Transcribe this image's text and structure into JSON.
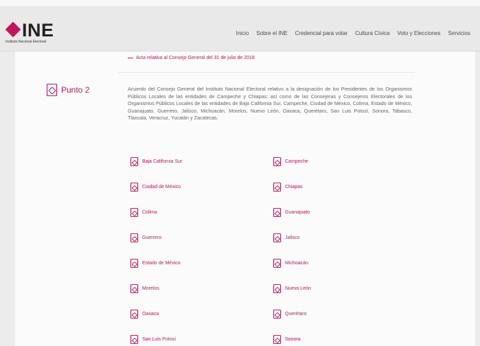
{
  "header": {
    "logo_text": "INE",
    "logo_sub": "Instituto Nacional Electoral",
    "nav": [
      "Inicio",
      "Sobre el INE",
      "Credencial para votar",
      "Cultura Cívica",
      "Voto y Elecciones",
      "Servicios"
    ]
  },
  "prev_link": "Acta relativa al Consejo General del 31 de julio de 2018",
  "punto": {
    "label": "Punto 2",
    "description": "Acuerdo del Consejo General del Instituto Nacional Electoral relativo a la designación de los Presidentes de los Organismos Públicos Locales de las entidades de Campeche y Chiapas; así como de las Consejeras y Consejeros Electorales de los Organismos Públicos Locales de las entidades de Baja California Sur, Campeche, Ciudad de México, Colima, Estado de México, Guanajuato, Guerrero, Jalisco, Michoacán, Morelos, Nuevo León, Oaxaca, Querétaro, San Luis Potosí, Sonora, Tabasco, Tlaxcala, Veracruz, Yucatán y Zacatecas."
  },
  "links": [
    {
      "left": "Baja California Sur",
      "right": "Campeche"
    },
    {
      "left": "Ciudad de México",
      "right": "Chiapas"
    },
    {
      "left": "Colima",
      "right": "Guanajuato"
    },
    {
      "left": "Guerrero",
      "right": "Jalisco"
    },
    {
      "left": "Estado de México",
      "right": "Michoacán"
    },
    {
      "left": "Morelos",
      "right": "Nuevo León"
    },
    {
      "left": "Oaxaca",
      "right": "Querétaro"
    },
    {
      "left": "San Luis Potosí",
      "right": "Sonora"
    }
  ],
  "colors": {
    "accent": "#c2185b"
  }
}
